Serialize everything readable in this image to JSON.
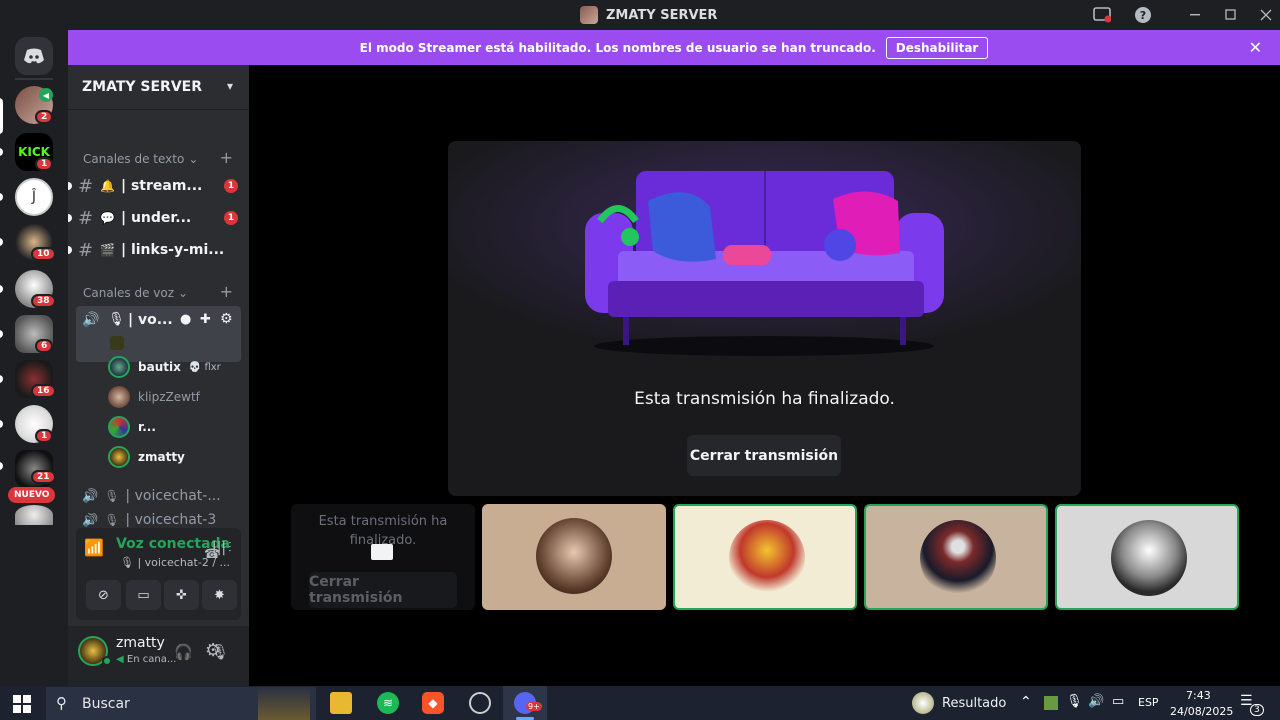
{
  "window": {
    "title": "ZMATY SERVER"
  },
  "banner": {
    "text": "El modo Streamer está habilitado. Los nombres de usuario se han truncado.",
    "button_label": "Deshabilitar"
  },
  "rail": {
    "badges": [
      "2",
      "1",
      "10",
      "38",
      "6",
      "16",
      "1",
      "21"
    ],
    "kick_label": "KICK",
    "nuevo_label": "NUEVO"
  },
  "sidebar": {
    "server_name": "ZMATY SERVER",
    "text_category": "Canales de texto",
    "voice_category": "Canales de voz",
    "text_channels": [
      {
        "icon": "🔔",
        "name": "| stream...",
        "count": "1"
      },
      {
        "icon": "💬",
        "name": "| under...",
        "count": "1"
      },
      {
        "icon": "🎬",
        "name": "| links-y-mi...",
        "count": ""
      }
    ],
    "active_voice": {
      "name": "| vo..."
    },
    "users": [
      {
        "name": "bautix",
        "tag": "flxr"
      },
      {
        "name": "klipzZewtf",
        "tag": ""
      },
      {
        "name": "r...",
        "tag": ""
      },
      {
        "name": "zmatty",
        "tag": ""
      }
    ],
    "other_voice": [
      "| voicechat-...",
      "| voicechat-3"
    ]
  },
  "voice_panel": {
    "status": "Voz conectada",
    "channel": "| voicechat-2 / ..."
  },
  "user_panel": {
    "name": "zmatty",
    "status": "En cana..."
  },
  "stage": {
    "message": "Esta transmisión ha finalizado.",
    "close_label": "Cerrar transmisión"
  },
  "mini_stream": {
    "message": "Esta transmisión ha finalizado.",
    "close_label": "Cerrar transmisión"
  },
  "taskbar": {
    "search_placeholder": "Buscar",
    "weather_label": "Resultado",
    "lang": "ESP",
    "time": "7:43",
    "date": "24/08/2025",
    "notif_count": "3",
    "discord_badge": "9+"
  },
  "colors": {
    "accent": "#9b4cf0",
    "speaking": "#23a55a",
    "badge": "#da373c",
    "voice_green": "#23a55a"
  }
}
